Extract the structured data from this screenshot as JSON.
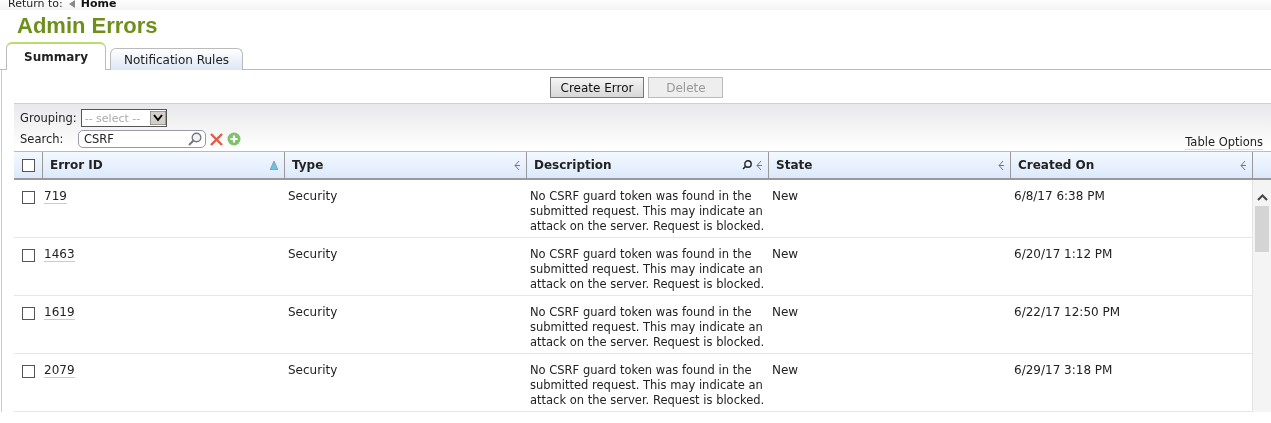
{
  "breadcrumb": {
    "label": "Return to:",
    "link": "Home"
  },
  "title": "Admin Errors",
  "tabs": [
    {
      "label": "Summary",
      "selected": true
    },
    {
      "label": "Notification Rules",
      "selected": false
    }
  ],
  "buttons": [
    {
      "label": "Create Error",
      "disabled": false
    },
    {
      "label": "Delete",
      "disabled": true
    }
  ],
  "grouping": {
    "label": "Grouping:",
    "placeholder": "-- select --"
  },
  "search": {
    "label": "Search:",
    "value": "CSRF"
  },
  "table_options": "Table Options",
  "table": {
    "select_all_checked": false,
    "columns": [
      {
        "label": "Error ID",
        "sorted": true,
        "searchable": false
      },
      {
        "label": "Type",
        "sorted": false,
        "searchable": false
      },
      {
        "label": "Description",
        "sorted": false,
        "searchable": true
      },
      {
        "label": "State",
        "sorted": false,
        "searchable": false
      },
      {
        "label": "Created On",
        "sorted": false,
        "searchable": false
      }
    ],
    "rows": [
      {
        "checked": false,
        "id": "719",
        "type": "Security",
        "description": "No CSRF guard token was found in the submitted request. This may indicate an attack on the server. Request is blocked.",
        "state": "New",
        "created": "6/8/17 6:38 PM"
      },
      {
        "checked": false,
        "id": "1463",
        "type": "Security",
        "description": "No CSRF guard token was found in the submitted request. This may indicate an attack on the server. Request is blocked.",
        "state": "New",
        "created": "6/20/17 1:12 PM"
      },
      {
        "checked": false,
        "id": "1619",
        "type": "Security",
        "description": "No CSRF guard token was found in the submitted request. This may indicate an attack on the server. Request is blocked.",
        "state": "New",
        "created": "6/22/17 12:50 PM"
      },
      {
        "checked": false,
        "id": "2079",
        "type": "Security",
        "description": "No CSRF guard token was found in the submitted request. This may indicate an attack on the server. Request is blocked.",
        "state": "New",
        "created": "6/29/17 3:18 PM"
      }
    ]
  }
}
